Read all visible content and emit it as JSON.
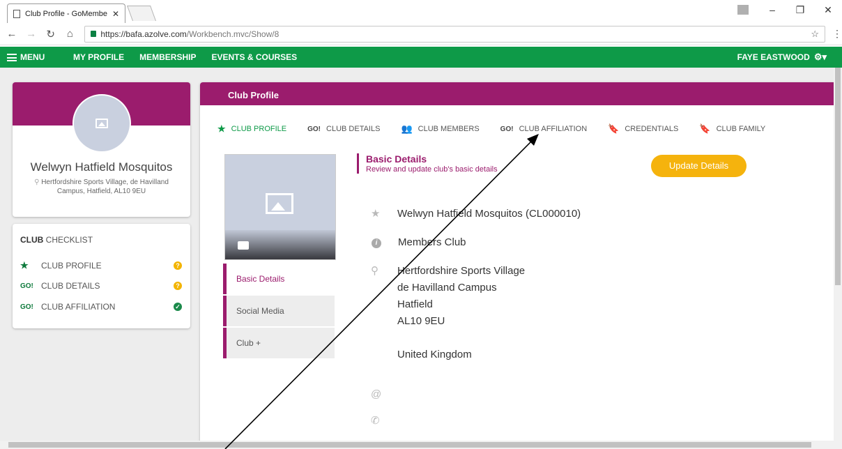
{
  "browser": {
    "tab_title": "Club Profile - GoMembe",
    "url_host": "https://bafa.azolve.com",
    "url_path": "/Workbench.mvc/Show/8"
  },
  "nav": {
    "menu": "MENU",
    "links": [
      "MY PROFILE",
      "MEMBERSHIP",
      "EVENTS & COURSES"
    ],
    "user": "FAYE EASTWOOD"
  },
  "club": {
    "name": "Welwyn Hatfield Mosquitos",
    "address": "Hertfordshire Sports Village, de Havilland Campus, Hatfield, AL10 9EU"
  },
  "checklist": {
    "title_bold": "CLUB",
    "title_rest": "CHECKLIST",
    "items": [
      {
        "label": "CLUB PROFILE",
        "status": "warning"
      },
      {
        "label": "CLUB DETAILS",
        "status": "warning"
      },
      {
        "label": "CLUB AFFILIATION",
        "status": "complete"
      }
    ]
  },
  "main": {
    "header": "Club Profile",
    "tabs": [
      "CLUB PROFILE",
      "CLUB DETAILS",
      "CLUB MEMBERS",
      "CLUB AFFILIATION",
      "CREDENTIALS",
      "CLUB FAMILY"
    ],
    "side_tabs": [
      "Basic Details",
      "Social Media",
      "Club +"
    ],
    "section_title": "Basic Details",
    "section_subtitle": "Review and update club's basic details",
    "update_button": "Update Details",
    "club_full_name": "Welwyn Hatfield Mosquitos (CL000010)",
    "club_type": "Members Club",
    "address_lines": [
      "Hertfordshire Sports Village",
      "de Havilland Campus",
      "Hatfield",
      "AL10 9EU",
      "",
      "United Kingdom"
    ]
  },
  "colors": {
    "nav_green": "#0e9a48",
    "brand_purple": "#9b1c6d",
    "accent_yellow": "#f5b30d"
  }
}
